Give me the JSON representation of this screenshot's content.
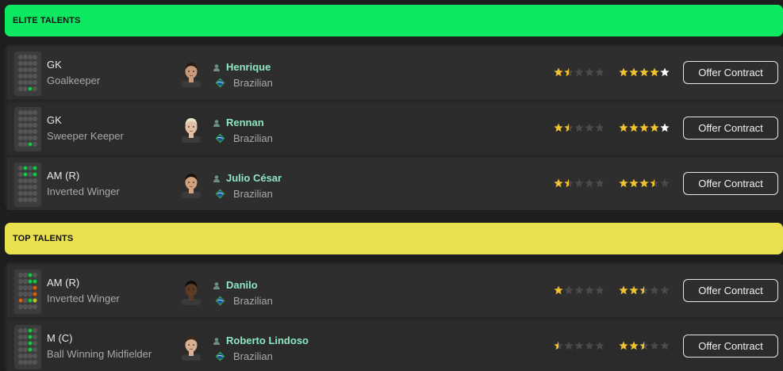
{
  "sections": [
    {
      "title": "ELITE TALENTS",
      "color": "#0ce960",
      "players": [
        {
          "position": "GK",
          "role": "Goalkeeper",
          "name": "Henrique",
          "nation": "Brazilian",
          "current": 1.5,
          "potential": 4,
          "button": "Offer Contract",
          "face": "henrique-portrait"
        },
        {
          "position": "GK",
          "role": "Sweeper Keeper",
          "name": "Rennan",
          "nation": "Brazilian",
          "current": 1.5,
          "potential": 4,
          "button": "Offer Contract",
          "face": "rennan-portrait"
        },
        {
          "position": "AM (R)",
          "role": "Inverted Winger",
          "name": "Julio César",
          "nation": "Brazilian",
          "current": 1.5,
          "potential": 3.5,
          "button": "Offer Contract",
          "face": "julio-cesar-portrait"
        }
      ]
    },
    {
      "title": "TOP TALENTS",
      "color": "#e8e04c",
      "players": [
        {
          "position": "AM (R)",
          "role": "Inverted Winger",
          "name": "Danilo",
          "nation": "Brazilian",
          "current": 1,
          "potential": 2.5,
          "button": "Offer Contract",
          "face": "danilo-portrait"
        },
        {
          "position": "M (C)",
          "role": "Ball Winning Midfielder",
          "name": "Roberto Lindoso",
          "nation": "Brazilian",
          "current": 0.5,
          "potential": 2.5,
          "button": "Offer Contract",
          "face": "roberto-lindoso-portrait"
        }
      ]
    }
  ],
  "colors": {
    "star_full": "#f2c230",
    "star_empty": "#4a4a4a",
    "star_white": "#ffffff",
    "name": "#8ee6c2"
  }
}
